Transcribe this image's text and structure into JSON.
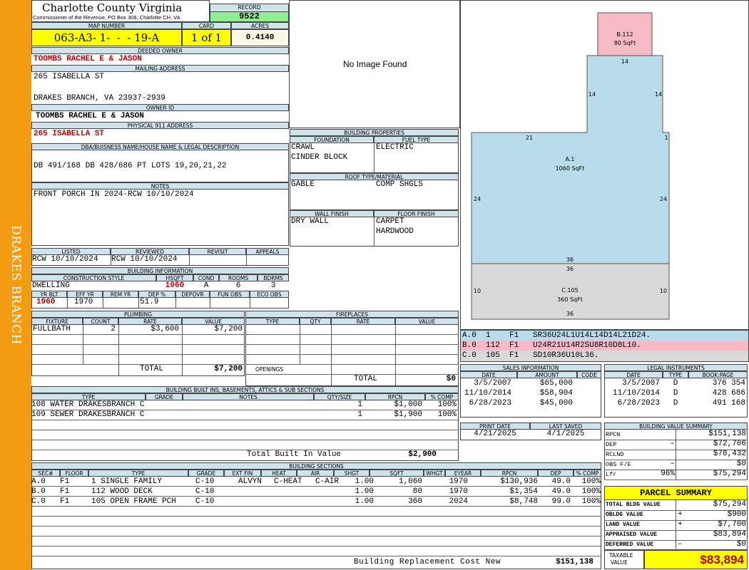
{
  "side_label": "DRAKES BRANCH",
  "header": {
    "county": "Charlotte County Virginia",
    "commissioner": "Commissioner of the Revenue, PO Box 308, Charlotte CH, VA",
    "record_label": "RECORD",
    "record": "9522",
    "map_number_label": "MAP NUMBER",
    "map_number": "063-A3- 1-  -  - 19-A",
    "card_label": "CARD",
    "card": "1 of 1",
    "acres_label": "ACRES",
    "acres": "0.4140"
  },
  "owner": {
    "deeded_label": "DEEDED OWNER",
    "deeded": "TOOMBS RACHEL E & JASON",
    "mailing_label": "MAILING ADDRESS",
    "mailing_line1": "265 ISABELLA ST",
    "mailing_line2": "DRAKES BRANCH, VA 23937-2939",
    "owner_id_label": "OWNER ID",
    "owner_id": "TOOMBS RACHEL E & JASON",
    "physical_label": "PHYSICAL 911 ADDRESS",
    "physical": "265 ISABELLA ST",
    "dba_label": "DBA/BUISNESS NAME/HOUSE NAME & LEGAL DESCRIPTION",
    "legal": "DB 491/168 DB 428/686 PT LOTS 19,20,21,22",
    "notes_label": "NOTES",
    "notes": "FRONT PORCH IN 2024-RCW 10/10/2024"
  },
  "image_placeholder": "No Image Found",
  "building_properties": {
    "title": "BUILDING PROPERTIES",
    "foundation_label": "FOUNDATION",
    "foundation1": "CRAWL",
    "foundation2": "CINDER BLOCK",
    "fuel_label": "FUEL TYPE",
    "fuel": "ELECTRIC",
    "roof_label": "ROOF TYPE/MATERIAL",
    "roof_type": "GABLE",
    "roof_material": "COMP SHGLS",
    "wall_label": "WALL FINISH",
    "wall": "DRY WALL",
    "floor_label": "FLOOR FINISH",
    "floor1": "CARPET",
    "floor2": "HARDWOOD"
  },
  "status": {
    "listed_label": "LISTED",
    "listed": "RCW 10/10/2024",
    "reviewed_label": "REVIEWED",
    "reviewed": "RCW 10/10/2024",
    "revisit_label": "REVISIT",
    "appeals_label": "APPEALS"
  },
  "building_info": {
    "title": "BUILDING INFORMATION",
    "headers1": [
      "CONSTRUCTION STYLE",
      "HSQFT",
      "COND",
      "ROOMS",
      "BDRMS"
    ],
    "style": "DWELLING",
    "hsqft": "1060",
    "cond": "A",
    "rooms": "6",
    "bdrms": "3",
    "headers2": [
      "YR BLT",
      "EFF YR",
      "REM YR",
      "DEP %",
      "DEPOVR",
      "FUN OBS",
      "ECO OBS"
    ],
    "yr_blt": "1960",
    "eff_yr": "1970",
    "rem_yr": "",
    "dep_pct": "51.9"
  },
  "plumbing": {
    "title": "PLUMBING",
    "headers": [
      "FIXTURE",
      "COUNT",
      "RATE",
      "VALUE"
    ],
    "rows": [
      {
        "fixture": "FULLBATH",
        "count": "2",
        "rate": "$3,600",
        "value": "$7,200"
      }
    ],
    "total_label": "TOTAL",
    "total": "$7,200"
  },
  "fireplaces": {
    "title": "FIREPLACES",
    "headers": [
      "TYPE",
      "QTY",
      "RATE",
      "VALUE"
    ],
    "openings_label": "OPENINGS",
    "total_label": "TOTAL",
    "total": "$0"
  },
  "built_ins": {
    "title": "BUILDING BUILT INS, BASEMENTS, ATTICS & SUB SECTIONS",
    "headers": [
      "TYPE",
      "GRADE",
      "NOTES",
      "QTY/SIZE",
      "RPCN",
      "% COMP"
    ],
    "rows": [
      {
        "type": "108 WATER DRAKESBRANCH C",
        "qty": "1",
        "rpcn": "$1,000",
        "comp": "100%"
      },
      {
        "type": "109 SEWER DRAKESBRANCH C",
        "qty": "1",
        "rpcn": "$1,900",
        "comp": "100%"
      }
    ],
    "total_label": "Total Built In Value",
    "total": "$2,900"
  },
  "sections": {
    "title": "BUILDING SECTIONS",
    "headers": [
      "SEC#",
      "FLOOR",
      "TYPE",
      "GRADE",
      "EXT FIN",
      "HEAT",
      "AIR",
      "SHGT",
      "SQFT",
      "WHGT",
      "EYEAR",
      "RPCN",
      "DEP",
      "% COMP"
    ],
    "rows": [
      {
        "sec": "A.0",
        "floor": "F1",
        "type": "1 SINGLE FAMILY",
        "grade": "C-10",
        "ext": "ALVYN",
        "heat": "C-HEAT",
        "air": "C-AIR",
        "shgt": "1.00",
        "sqft": "1,060",
        "eyear": "1970",
        "rpcn": "$130,936",
        "dep": "49.0",
        "comp": "100%"
      },
      {
        "sec": "B.0",
        "floor": "F1",
        "type": "112 WOOD DECK",
        "grade": "C-10",
        "ext": "",
        "heat": "",
        "air": "",
        "shgt": "1.00",
        "sqft": "80",
        "eyear": "1970",
        "rpcn": "$1,354",
        "dep": "49.0",
        "comp": "100%"
      },
      {
        "sec": "C.0",
        "floor": "F1",
        "type": "105 OPEN FRAME PCH",
        "grade": "C-10",
        "ext": "",
        "heat": "",
        "air": "",
        "shgt": "1.00",
        "sqft": "360",
        "eyear": "2024",
        "rpcn": "$8,748",
        "dep": "99.0",
        "comp": "100%"
      }
    ],
    "replacement_label": "Building Replacement Cost New",
    "replacement": "$151,138"
  },
  "sketch": {
    "b_label": "B.112",
    "b_area": "80 SqFt",
    "a_label": "A.1",
    "a_area": "1060 SqFt",
    "c_label": "C.105",
    "c_area": "360 SqFt",
    "dims": {
      "b_bottom": "14",
      "a_left_upper": "14",
      "a_right_upper": "14",
      "a_top_left": "21",
      "a_top_right": "1",
      "a_left": "24",
      "a_right": "24",
      "a_bottom": "36",
      "c_top": "36",
      "c_left": "10",
      "c_right": "10",
      "c_bottom": "36"
    },
    "codes": [
      {
        "text": "A.0  1    F1   SR36U24L1U14L14D14L21D24.",
        "color": "#b9dcea"
      },
      {
        "text": "B.0  112  F1   U24R21U14R2SU8R10D8L10.",
        "color": "#f7b9c3"
      },
      {
        "text": "C.0  105  F1   SD10R36U10L36.",
        "color": "#d9d9d9"
      }
    ]
  },
  "sales": {
    "title": "SALES INFORMATION",
    "headers": [
      "DATE",
      "AMOUNT",
      "CODE"
    ],
    "rows": [
      {
        "date": "3/5/2007",
        "amount": "$65,000",
        "code": ""
      },
      {
        "date": "11/10/2014",
        "amount": "$58,904",
        "code": ""
      },
      {
        "date": "6/28/2023",
        "amount": "$45,000",
        "code": ""
      }
    ]
  },
  "legal_instruments": {
    "title": "LEGAL INSTRUMENTS",
    "headers": [
      "DATE",
      "TYPE",
      "BOOK:PAGE"
    ],
    "rows": [
      {
        "date": "3/5/2007",
        "type": "D",
        "book": "376 354"
      },
      {
        "date": "11/10/2014",
        "type": "D",
        "book": "428 686"
      },
      {
        "date": "6/28/2023",
        "type": "D",
        "book": "491 168"
      }
    ]
  },
  "print": {
    "print_label": "PRINT DATE",
    "print_date": "4/21/2025",
    "saved_label": "LAST SAVED",
    "saved_date": "4/1/2025"
  },
  "value_summary": {
    "title": "BUILDING VALUE SUMMARY",
    "rows": [
      {
        "label": "RPCN",
        "sign": "",
        "value": "$151,138"
      },
      {
        "label": "DEP",
        "sign": "–",
        "value": "$72,706"
      },
      {
        "label": "RCLND",
        "sign": "",
        "value": "$78,432"
      },
      {
        "label": "OBS F/E",
        "sign": "–",
        "value": "$0"
      },
      {
        "label": "Lfr",
        "sign": "96%",
        "value": "$75,294"
      }
    ]
  },
  "parcel_summary": {
    "title": "PARCEL SUMMARY",
    "rows": [
      {
        "label": "TOTAL BLDG VALUE",
        "sign": "",
        "value": "$75,294"
      },
      {
        "label": "OBLDG VALUE",
        "sign": "+",
        "value": "$900"
      },
      {
        "label": "LAND VALUE",
        "sign": "+",
        "value": "$7,700"
      },
      {
        "label": "APPRAISED VALUE",
        "sign": "",
        "value": "$83,894"
      },
      {
        "label": "DEFERRED VALUE",
        "sign": "–",
        "value": "$0"
      }
    ],
    "taxable_label1": "TAXABLE",
    "taxable_label2": "VALUE",
    "taxable": "$83,894"
  }
}
